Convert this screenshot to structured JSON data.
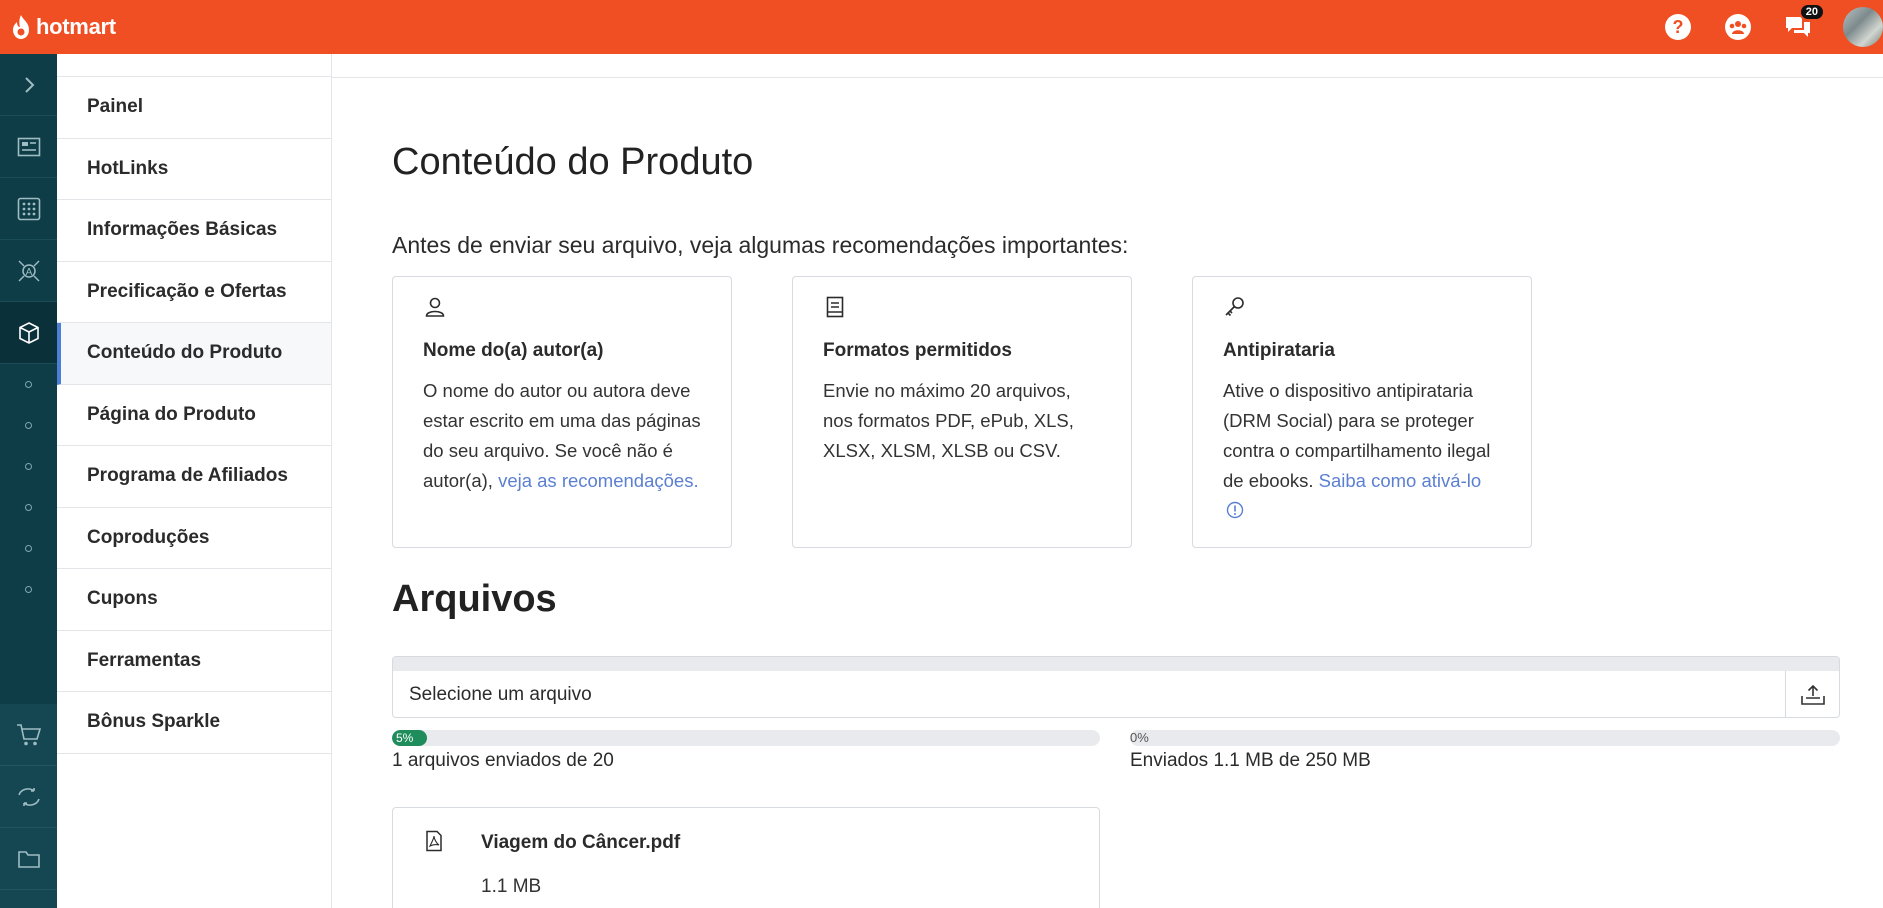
{
  "brand": {
    "name": "hotmart",
    "color": "#f04e23"
  },
  "topbar": {
    "help_icon": "question-circle-icon",
    "community_icon": "community-icon",
    "chat_icon": "chat-bubbles-icon",
    "chat_badge": "20"
  },
  "rail": {
    "items": [
      "chevron-right-icon",
      "dashboard-icon",
      "apps-grid-icon",
      "affiliate-network-icon",
      "product-box-icon"
    ],
    "dots": 6,
    "lower_items": [
      "cart-icon",
      "refresh-icon",
      "folder-icon"
    ]
  },
  "subnav": {
    "items": [
      {
        "label": "Painel"
      },
      {
        "label": "HotLinks"
      },
      {
        "label": "Informações Básicas"
      },
      {
        "label": "Precificação e Ofertas"
      },
      {
        "label": "Conteúdo do Produto",
        "active": true
      },
      {
        "label": "Página do Produto"
      },
      {
        "label": "Programa de Afiliados"
      },
      {
        "label": "Coproduções"
      },
      {
        "label": "Cupons"
      },
      {
        "label": "Ferramentas"
      },
      {
        "label": "Bônus Sparkle"
      }
    ]
  },
  "main": {
    "title": "Conteúdo do Produto",
    "intro": "Antes de enviar seu arquivo, veja algumas recomendações importantes:",
    "cards": [
      {
        "icon": "user-icon",
        "title": "Nome do(a) autor(a)",
        "text": "O nome do autor ou autora deve estar escrito em uma das páginas do seu arquivo. Se você não é autor(a), ",
        "link": "veja as recomendações."
      },
      {
        "icon": "document-icon",
        "title": "Formatos permitidos",
        "text": "Envie no máximo 20 arquivos, nos formatos PDF, ePub, XLS, XLSX, XLSM, XLSB ou CSV.",
        "link": ""
      },
      {
        "icon": "key-icon",
        "title": "Antipirataria",
        "text": "Ative o dispositivo antipirataria (DRM Social) para se proteger contra o compartilhamento ilegal de ebooks. ",
        "link": "Saiba como ativá-lo"
      }
    ],
    "files_title": "Arquivos",
    "upload": {
      "placeholder": "Selecione um arquivo",
      "button_icon": "upload-icon"
    },
    "progress": [
      {
        "percent": 5,
        "label_pct": "5%",
        "text": "1 arquivos enviados de 20"
      },
      {
        "percent": 0,
        "label_pct": "0%",
        "text": "Enviados 1.1 MB de 250 MB"
      }
    ],
    "file": {
      "icon": "pdf-file-icon",
      "name": "Viagem do Câncer.pdf",
      "size": "1.1 MB"
    }
  }
}
